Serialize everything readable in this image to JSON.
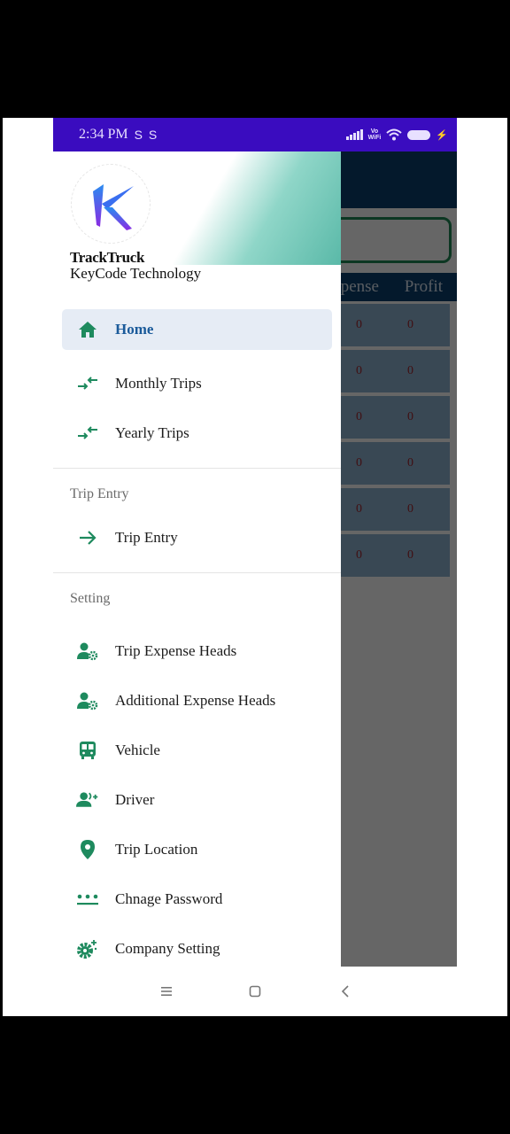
{
  "status_bar": {
    "time": "2:34 PM",
    "notification_icons": [
      "S",
      "S"
    ],
    "vowifi_top": "Vo",
    "vowifi_bottom": "WiFi"
  },
  "drawer": {
    "app_name": "TrackTruck",
    "company_name": "KeyCode Technology",
    "main_items": [
      {
        "label": "Home",
        "icon": "home-icon",
        "active": true
      },
      {
        "label": "Monthly Trips",
        "icon": "swap-arrows-icon"
      },
      {
        "label": "Yearly Trips",
        "icon": "swap-arrows-icon"
      }
    ],
    "sections": [
      {
        "title": "Trip Entry",
        "items": [
          {
            "label": "Trip Entry",
            "icon": "arrow-right-icon"
          }
        ]
      },
      {
        "title": "Setting",
        "items": [
          {
            "label": "Trip Expense Heads",
            "icon": "user-gear-icon"
          },
          {
            "label": "Additional Expense Heads",
            "icon": "user-gear-icon"
          },
          {
            "label": "Vehicle",
            "icon": "bus-icon"
          },
          {
            "label": "Driver",
            "icon": "user-add-icon"
          },
          {
            "label": "Trip Location",
            "icon": "location-pin-icon"
          },
          {
            "label": "Chnage Password",
            "icon": "password-icon"
          },
          {
            "label": "Company Setting",
            "icon": "settings-gear-icon"
          }
        ]
      }
    ]
  },
  "background_app": {
    "table_headers": {
      "expense": "pense",
      "profit": "Profit"
    },
    "rows": [
      {
        "expense": "0",
        "profit": "0"
      },
      {
        "expense": "0",
        "profit": "0"
      },
      {
        "expense": "0",
        "profit": "0"
      },
      {
        "expense": "0",
        "profit": "0"
      },
      {
        "expense": "0",
        "profit": "0"
      },
      {
        "expense": "0",
        "profit": "0"
      }
    ]
  },
  "colors": {
    "status_bar": "#3a0cbf",
    "accent_green": "#1e8a5e",
    "active_text": "#1a5a9a",
    "active_bg": "#e6ecf5",
    "app_header": "#0a3f6e"
  }
}
